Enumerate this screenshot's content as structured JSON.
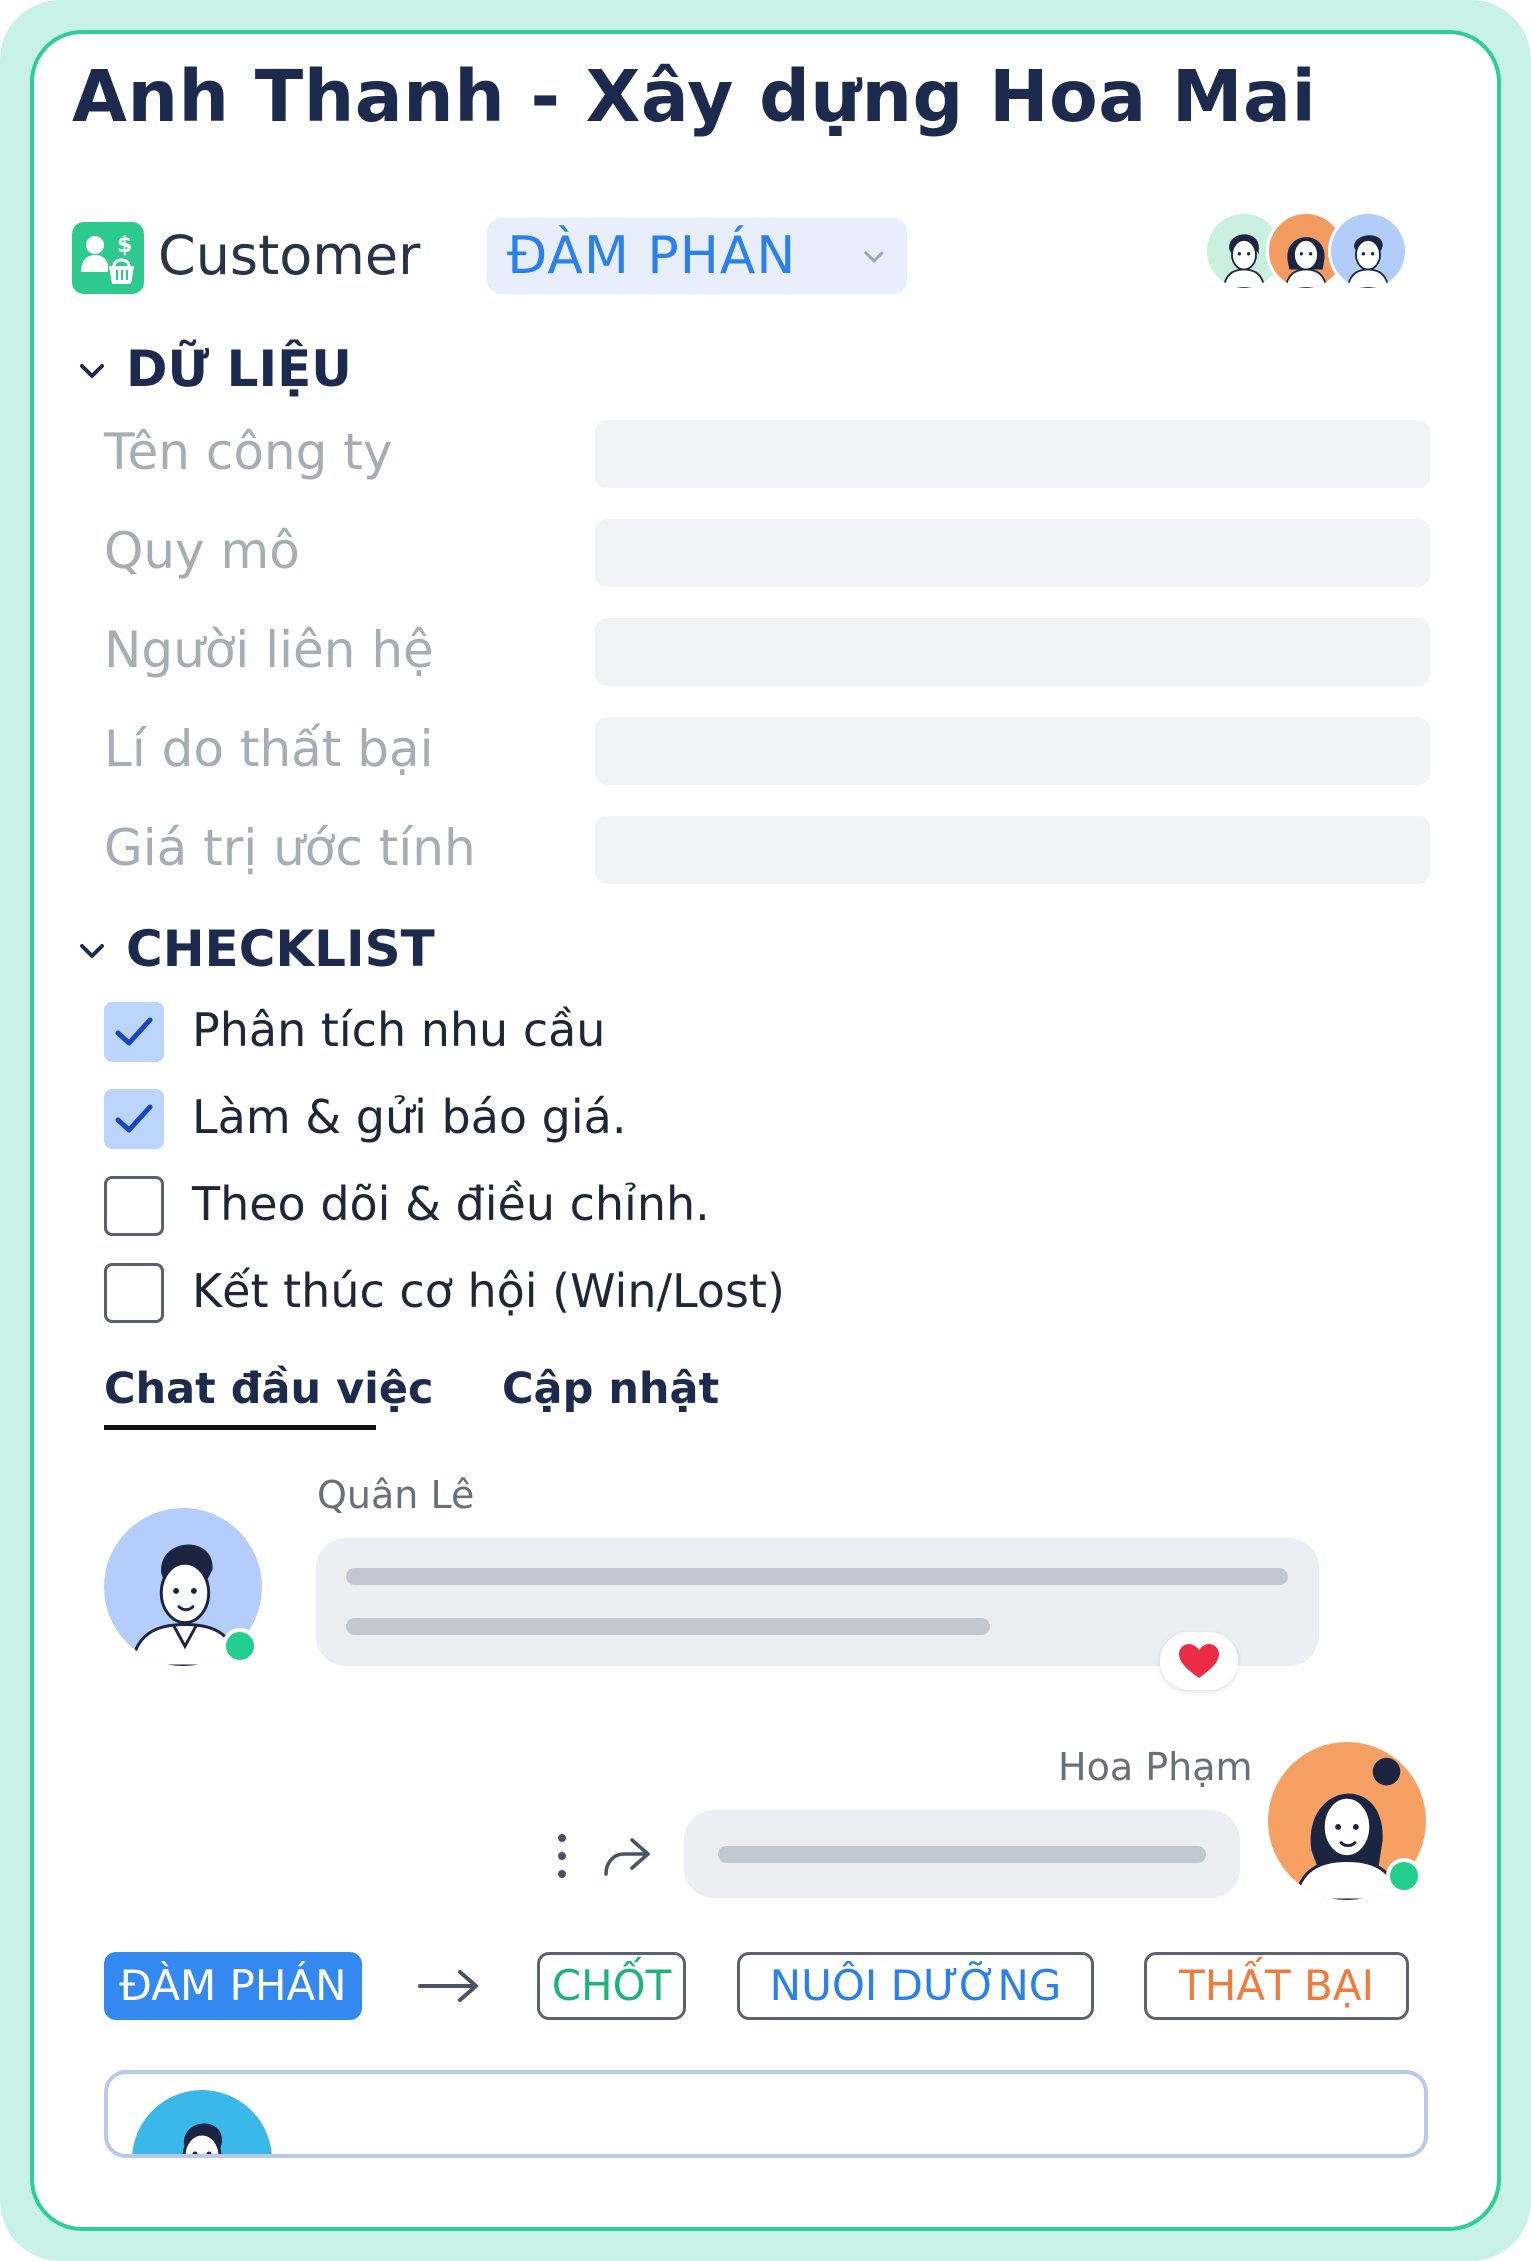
{
  "header": {
    "title": "Anh Thanh - Xây dựng Hoa Mai",
    "record_type": "Customer",
    "stage": "ĐÀM PHÁN"
  },
  "data_section": {
    "heading": "DỮ LIỆU",
    "fields": [
      {
        "label": "Tên công ty",
        "value": ""
      },
      {
        "label": "Quy mô",
        "value": ""
      },
      {
        "label": "Người liên hệ",
        "value": ""
      },
      {
        "label": "Lí do thất bại",
        "value": ""
      },
      {
        "label": "Giá trị ước tính",
        "value": ""
      }
    ]
  },
  "checklist": {
    "heading": "CHECKLIST",
    "items": [
      {
        "label": "Phân tích nhu cầu",
        "checked": true
      },
      {
        "label": "Làm & gửi báo giá.",
        "checked": true
      },
      {
        "label": "Theo dõi & điều chỉnh.",
        "checked": false
      },
      {
        "label": "Kết thúc cơ hội (Win/Lost)",
        "checked": false
      }
    ]
  },
  "tabs": [
    {
      "label": "Chat đầu việc",
      "active": true
    },
    {
      "label": "Cập nhật",
      "active": false
    }
  ],
  "chat": [
    {
      "sender": "Quân Lê",
      "reaction": "heart-icon"
    },
    {
      "sender": "Hoa Phạm"
    }
  ],
  "stage_flow": {
    "current": "ĐÀM PHÁN",
    "options": [
      {
        "label": "CHỐT",
        "color": "#1fb37a"
      },
      {
        "label": "NUÔI DƯỠNG",
        "color": "#2b80f0"
      },
      {
        "label": "THẤT BẠI",
        "color": "#f27b3c"
      }
    ]
  },
  "colors": {
    "brand": "#2ecf96",
    "accent": "#3389f0",
    "title": "#1c2b4d",
    "online": "#22cf8f"
  }
}
